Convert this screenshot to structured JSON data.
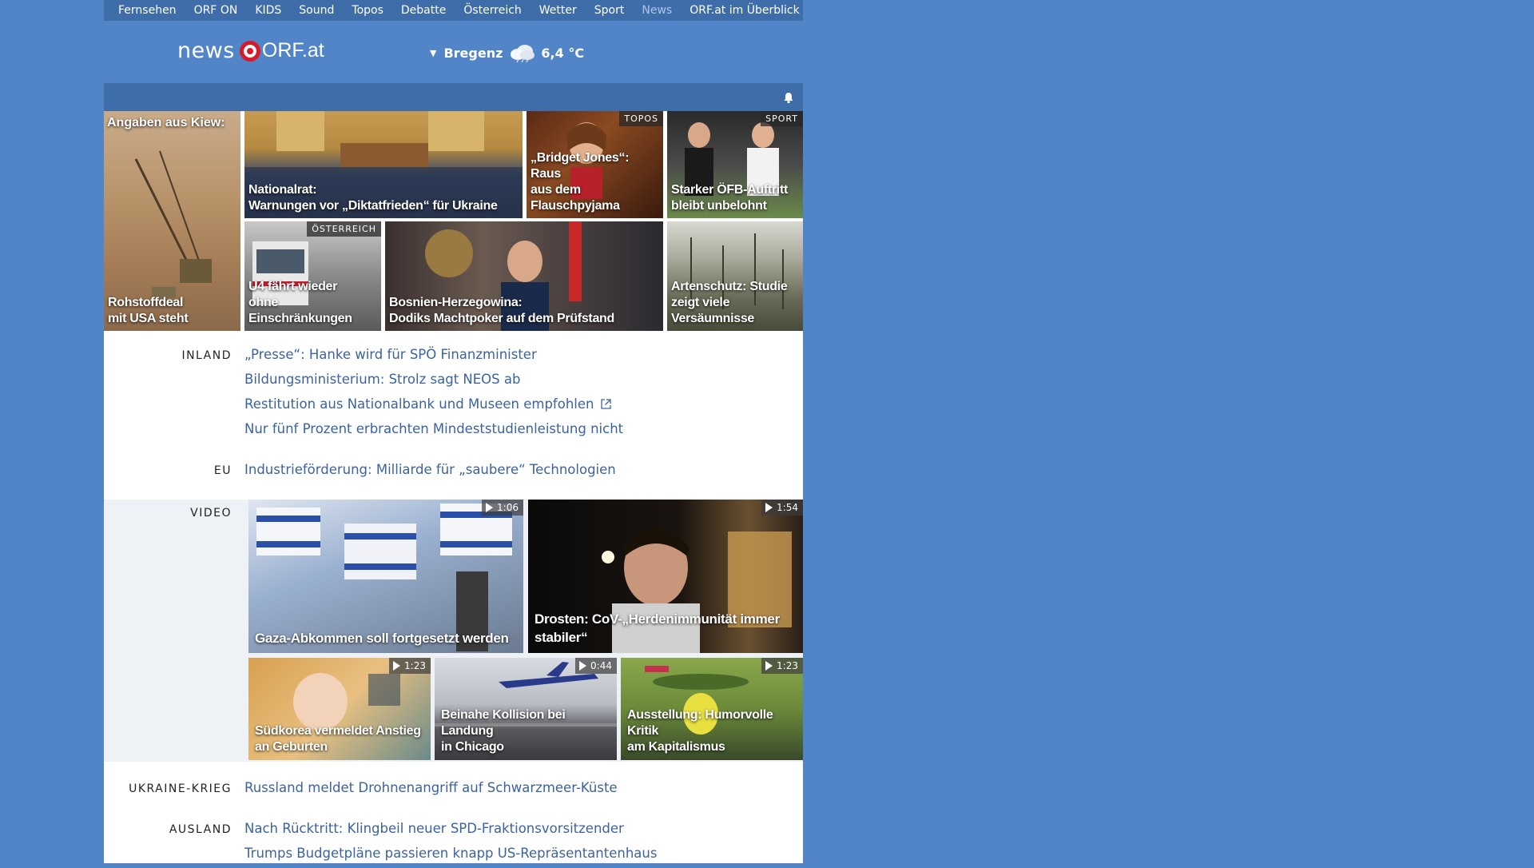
{
  "topnav": {
    "items": [
      "Fernsehen",
      "ORF ON",
      "KIDS",
      "Sound",
      "Topos",
      "Debatte",
      "Österreich",
      "Wetter",
      "Sport",
      "News"
    ],
    "overview": "ORF.at im Überblick"
  },
  "logo": {
    "news": "news",
    "orf": "ORF.at"
  },
  "weather": {
    "arrow": "▼",
    "city": "Bregenz",
    "temp": "6,4 °C",
    "icon": "cloud-rain-icon"
  },
  "colors": {
    "background": "#5185c8",
    "nav": "#3e6daa",
    "link": "#3a63a0",
    "accent_red": "#d91a2a"
  },
  "tiles": [
    {
      "kicker": "Angaben aus Kiew:",
      "caption1": "Rohstoffdeal",
      "caption2": "mit USA steht",
      "label": ""
    },
    {
      "kicker": "",
      "caption1": "Nationalrat:",
      "caption2": "Warnungen vor „Diktatfrieden“ für Ukraine",
      "label": ""
    },
    {
      "kicker": "",
      "caption1": "„Bridget Jones“: Raus",
      "caption2": "aus dem Flauschpyjama",
      "label": "TOPOS"
    },
    {
      "kicker": "",
      "caption1": "Starker ÖFB-Auftritt",
      "caption2": "bleibt unbelohnt",
      "label": "SPORT"
    },
    {
      "kicker": "",
      "caption1": "U4 fährt wieder",
      "caption2": "ohne Einschränkungen",
      "label": "ÖSTERREICH"
    },
    {
      "kicker": "",
      "caption1": "Bosnien-Herzegowina:",
      "caption2": "Dodiks Machtpoker auf dem Prüfstand",
      "label": ""
    },
    {
      "kicker": "",
      "caption1": "Artenschutz: Studie",
      "caption2": "zeigt viele Versäumnisse",
      "label": ""
    }
  ],
  "inland": {
    "heading": "INLAND",
    "links": [
      "„Presse“: Hanke wird für SPÖ Finanzminister",
      "Bildungsministerium: Strolz sagt NEOS ab",
      "Restitution aus Nationalbank und Museen empfohlen",
      "Nur fünf Prozent erbrachten Mindeststudienleistung nicht"
    ]
  },
  "eu": {
    "heading": "EU",
    "links": [
      "Industrieförderung: Milliarde für „saubere“ Technologien"
    ]
  },
  "video": {
    "heading": "VIDEO",
    "items": [
      {
        "caption1": "Gaza-Abkommen soll fortgesetzt werden",
        "caption2": "",
        "duration": "1:06"
      },
      {
        "caption1": "Drosten: CoV-„Herdenimmunität immer",
        "caption2": "stabiler“",
        "duration": "1:54"
      },
      {
        "caption1": "Südkorea vermeldet Anstieg",
        "caption2": "an Geburten",
        "duration": "1:23"
      },
      {
        "caption1": "Beinahe Kollision bei Landung",
        "caption2": "in Chicago",
        "duration": "0:44"
      },
      {
        "caption1": "Ausstellung: Humorvolle Kritik",
        "caption2": "am Kapitalismus",
        "duration": "1:23"
      }
    ]
  },
  "ukraine": {
    "heading": "UKRAINE-KRIEG",
    "links": [
      "Russland meldet Drohnenangriff auf Schwarzmeer-Küste"
    ]
  },
  "ausland": {
    "heading": "AUSLAND",
    "links": [
      "Nach Rücktritt: Klingbeil neuer SPD-Fraktionsvorsitzender",
      "Trumps Budgetpläne passieren knapp US-Repräsentantenhaus"
    ]
  }
}
